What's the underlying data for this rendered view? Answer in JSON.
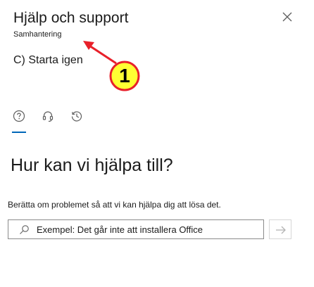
{
  "panel": {
    "title": "Hjälp och support",
    "subtitle": "Samhantering"
  },
  "annotation": {
    "text": "C) Starta igen",
    "badge": "1",
    "arrow_color": "#e8202a",
    "badge_fill": "#ffff33",
    "badge_stroke": "#e8202a"
  },
  "tabs": [
    {
      "icon": "help-circle-icon",
      "selected": true
    },
    {
      "icon": "headset-icon",
      "selected": false
    },
    {
      "icon": "history-icon",
      "selected": false
    }
  ],
  "main": {
    "heading": "Hur kan vi hjälpa till?",
    "description": "Berätta om problemet så att vi kan hjälpa dig att lösa det.",
    "search_placeholder": "Exempel: Det går inte att installera Office",
    "search_value": ""
  },
  "colors": {
    "accent": "#0067b8",
    "text": "#1b1b1b",
    "icon": "#5f5f5f"
  }
}
